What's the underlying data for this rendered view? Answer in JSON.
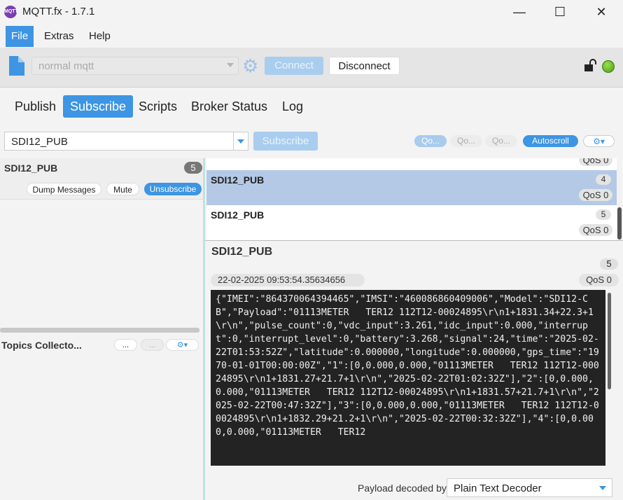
{
  "window": {
    "title": "MQTT.fx - 1.7.1",
    "app_icon_text": "MQTT",
    "minimize": "—",
    "maximize": "☐",
    "close": "✕"
  },
  "menu": {
    "file": "File",
    "extras": "Extras",
    "help": "Help"
  },
  "toolbar": {
    "profile": "normal mqtt",
    "connect": "Connect",
    "disconnect": "Disconnect",
    "connected": true
  },
  "tabs": {
    "publish": "Publish",
    "subscribe": "Subscribe",
    "scripts": "Scripts",
    "broker_status": "Broker Status",
    "log": "Log"
  },
  "subscribe_bar": {
    "topic": "SDI12_PUB",
    "subscribe": "Subscribe",
    "qos0": "Qo...",
    "qos1": "Qo...",
    "qos2": "Qo...",
    "autoscroll": "Autoscroll",
    "options": "⚙▾"
  },
  "subscription": {
    "topic": "SDI12_PUB",
    "count": "5",
    "dump": "Dump Messages",
    "mute": "Mute",
    "unsubscribe": "Unsubscribe"
  },
  "collectors": {
    "label": "Topics Collecto...",
    "btn1": "...",
    "btn2": "...",
    "btn3": "⚙▾"
  },
  "messages": [
    {
      "topic": "",
      "num": "",
      "qos": "QoS 0"
    },
    {
      "topic": "SDI12_PUB",
      "num": "4",
      "qos": "QoS 0"
    },
    {
      "topic": "SDI12_PUB",
      "num": "5",
      "qos": "QoS 0"
    }
  ],
  "detail": {
    "topic": "SDI12_PUB",
    "num": "5",
    "date": "22-02-2025  09:53:54.35634656",
    "qos": "QoS 0",
    "payload": "{\"IMEI\":\"864370064394465\",\"IMSI\":\"460086860409006\",\"Model\":\"SDI12-CB\",\"Payload\":\"01113METER   TER12 112T12-00024895\\r\\n1+1831.34+22.3+1\\r\\n\",\"pulse_count\":0,\"vdc_input\":3.261,\"idc_input\":0.000,\"interrupt\":0,\"interrupt_level\":0,\"battery\":3.268,\"signal\":24,\"time\":\"2025-02-22T01:53:52Z\",\"latitude\":0.000000,\"longitude\":0.000000,\"gps_time\":\"1970-01-01T00:00:00Z\",\"1\":[0,0.000,0.000,\"01113METER   TER12 112T12-00024895\\r\\n1+1831.27+21.7+1\\r\\n\",\"2025-02-22T01:02:32Z\"],\"2\":[0,0.000,0.000,\"01113METER   TER12 112T12-00024895\\r\\n1+1831.57+21.7+1\\r\\n\",\"2025-02-22T00:47:32Z\"],\"3\":[0,0.000,0.000,\"01113METER   TER12 112T12-00024895\\r\\n1+1832.29+21.2+1\\r\\n\",\"2025-02-22T00:32:32Z\"],\"4\":[0,0.000,0.000,\"01113METER   TER12"
  },
  "decoder": {
    "label": "Payload decoded by",
    "value": "Plain Text Decoder"
  }
}
